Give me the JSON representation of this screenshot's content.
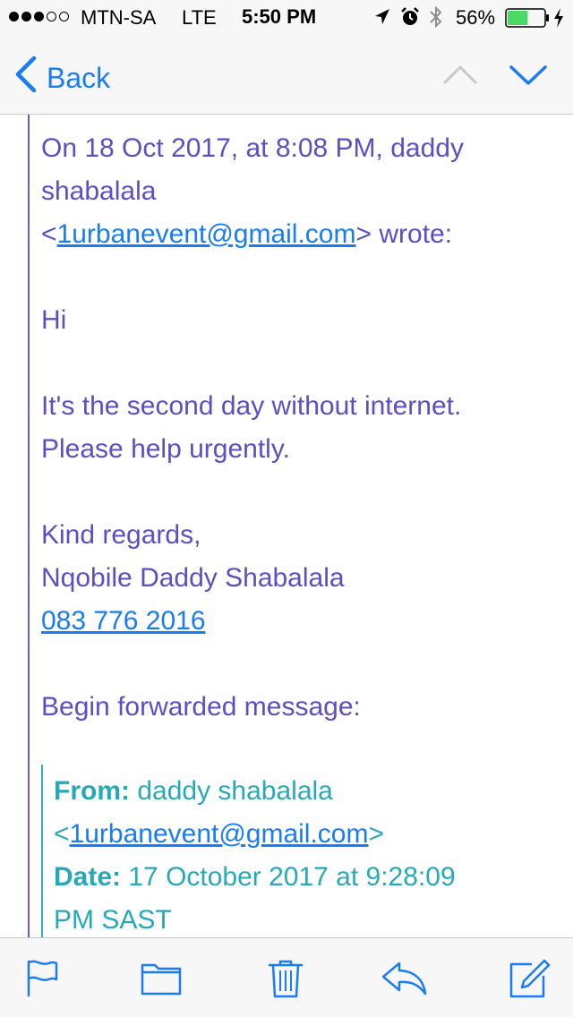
{
  "status_bar": {
    "carrier": "MTN-SA",
    "network": "LTE",
    "time": "5:50 PM",
    "battery_percent": "56%",
    "battery_level": 0.56,
    "signal_bars_filled": 3,
    "signal_bars_total": 5
  },
  "nav": {
    "back_label": "Back",
    "icons": [
      "chevron-left-icon",
      "chevron-up-icon",
      "chevron-down-icon"
    ]
  },
  "message": {
    "header_prefix": "On 18 Oct 2017, at 8:08 PM, daddy",
    "header_name": "shabalala",
    "header_lt": "<",
    "header_email": "1urbanevent@gmail.com",
    "header_suffix": "> wrote:",
    "greeting": "Hi",
    "body_line1": "It's the second day without internet.",
    "body_line2": "Please help urgently.",
    "signoff": "Kind regards,",
    "sender_name": "Nqobile Daddy Shabalala",
    "phone": "083 776 2016",
    "forward_intro": "Begin forwarded message:"
  },
  "forwarded": {
    "from_label": "From:",
    "from_name": "daddy shabalala",
    "from_lt": "<",
    "from_email": "1urbanevent@gmail.com",
    "from_gt": ">",
    "date_label": "Date:",
    "date_value": "17 October 2017 at 9:28:09",
    "date_tz": "PM SAST"
  },
  "toolbar": {
    "icons": [
      "flag-icon",
      "folder-icon",
      "trash-icon",
      "reply-icon",
      "compose-icon"
    ]
  },
  "colors": {
    "accent": "#1a7cf4",
    "quote_text": "#5b4fc4",
    "quote_bar": "#6a5acd",
    "forward_text": "#27a9b8",
    "battery_fill": "#4cd964"
  }
}
